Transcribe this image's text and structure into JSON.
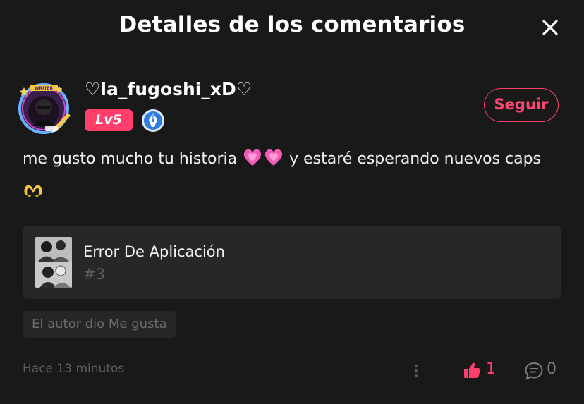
{
  "header": {
    "title": "Detalles de los comentarios"
  },
  "comment": {
    "username": "♡la_fugoshi_xD♡",
    "level": "Lv5",
    "avatar_banner": "WRITER",
    "follow_label": "Seguir",
    "text_part1": "me gusto mucho tu historia ",
    "text_part2": " y estaré esperando nuevos caps ",
    "emojis": [
      "growing-heart-icon",
      "growing-heart-icon",
      "heart-hands-icon"
    ],
    "time": "Hace 13 minutos",
    "likes": "1",
    "replies": "0"
  },
  "chapter": {
    "title": "Error De Aplicación",
    "number": "#3"
  },
  "author_liked": "El autor dio Me gusta",
  "colors": {
    "accent": "#ff3e6b",
    "background": "#191919",
    "card": "#272727",
    "pen_badge": "#2f7de1"
  }
}
